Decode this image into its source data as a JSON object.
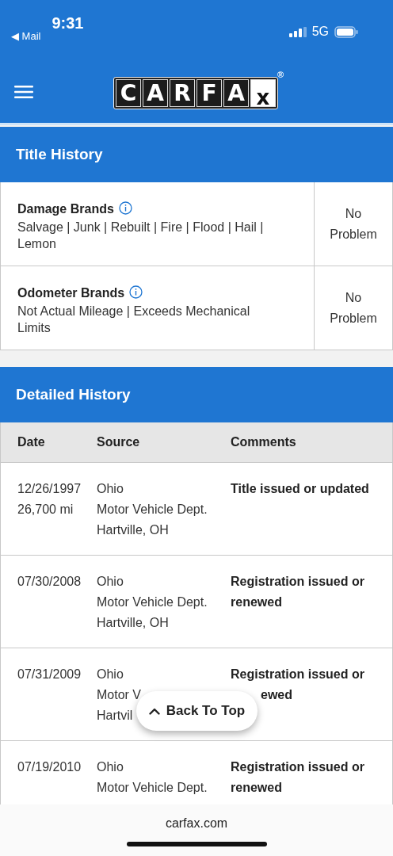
{
  "status_bar": {
    "back_label": "◀ Mail",
    "time": "9:31",
    "network": "5G"
  },
  "header": {
    "logo_letters": [
      "C",
      "A",
      "R",
      "F",
      "A",
      "x"
    ],
    "logo_mark": "®"
  },
  "title_history": {
    "heading": "Title History",
    "rows": [
      {
        "label": "Damage Brands",
        "detail": "Salvage | Junk | Rebuilt | Fire | Flood | Hail | Lemon",
        "result": "No Problem"
      },
      {
        "label": "Odometer Brands",
        "detail": "Not Actual Mileage | Exceeds Mechanical Limits",
        "result": "No Problem"
      }
    ]
  },
  "detailed_history": {
    "heading": "Detailed History",
    "columns": [
      "Date",
      "Source",
      "Comments"
    ],
    "rows": [
      {
        "date": [
          "12/26/1997",
          "26,700 mi"
        ],
        "source": [
          "Ohio",
          "Motor Vehicle Dept.",
          "Hartville, OH"
        ],
        "comments": [
          {
            "kind": "full",
            "text": "Title issued or updated"
          }
        ]
      },
      {
        "date": [
          "07/30/2008"
        ],
        "source": [
          "Ohio",
          "Motor Vehicle Dept.",
          "Hartville, OH"
        ],
        "comments": [
          {
            "kind": "full",
            "text": "Registration issued or renewed"
          }
        ]
      },
      {
        "date": [
          "07/31/2009"
        ],
        "source": [
          "Ohio",
          "Motor V",
          "Hartvil"
        ],
        "comments": [
          {
            "kind": "full",
            "text": "Registration issued or"
          },
          {
            "kind": "partial",
            "text": "ewed"
          }
        ]
      },
      {
        "date": [
          "07/19/2010"
        ],
        "source": [
          "Ohio",
          "Motor Vehicle Dept."
        ],
        "comments": [
          {
            "kind": "full",
            "text": "Registration issued or renewed"
          }
        ]
      }
    ]
  },
  "back_to_top": {
    "label": "Back To Top"
  },
  "browser_bar": {
    "url": "carfax.com"
  }
}
